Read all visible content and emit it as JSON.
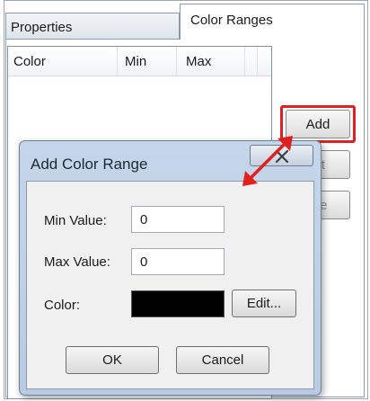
{
  "tabs": [
    {
      "label": "Properties"
    },
    {
      "label": "Color Ranges"
    }
  ],
  "list": {
    "columns": [
      "Color",
      "Min",
      "Max"
    ],
    "rows": []
  },
  "side_buttons": {
    "add_label": "Add",
    "edit_label": "dit",
    "delete_label": "ete"
  },
  "dialog": {
    "title": "Add Color Range",
    "min_label": "Min Value:",
    "min_value": "0",
    "max_label": "Max Value:",
    "max_value": "0",
    "color_label": "Color:",
    "color_value": "#000000",
    "color_edit_label": "Edit...",
    "ok_label": "OK",
    "cancel_label": "Cancel"
  },
  "annotation": {
    "highlight_color": "#e02020",
    "arrow_color": "#e02020"
  }
}
